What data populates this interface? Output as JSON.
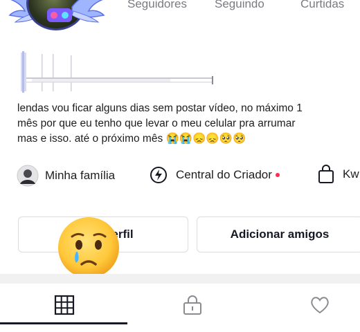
{
  "stats": {
    "followers_label": "Seguidores",
    "following_label": "Seguindo",
    "likes_label": "Curtidas"
  },
  "bio": {
    "text": "lendas vou ficar alguns dias sem postar vídeo, no máximo 1\nmês por que eu tenho que levar o meu celular pra arrumar\nmas e isso. até o próximo mês 😭😭😞😞🥺🥺"
  },
  "links": {
    "family_label": "Minha família",
    "creator_center_label": "Central do Criador",
    "shop_label": "Kw"
  },
  "buttons": {
    "edit_profile_label": "erfil",
    "add_friends_label": "Adicionar amigos"
  },
  "overlay": {
    "emoji": "crying-face"
  },
  "tabs": [
    {
      "icon": "grid-icon",
      "active": true
    },
    {
      "icon": "lock-icon",
      "active": false
    },
    {
      "icon": "heart-icon",
      "active": false
    }
  ],
  "colors": {
    "accent": "#fe2c55",
    "text": "#161823",
    "muted": "#7a7b80",
    "border": "#dcdcdf"
  }
}
